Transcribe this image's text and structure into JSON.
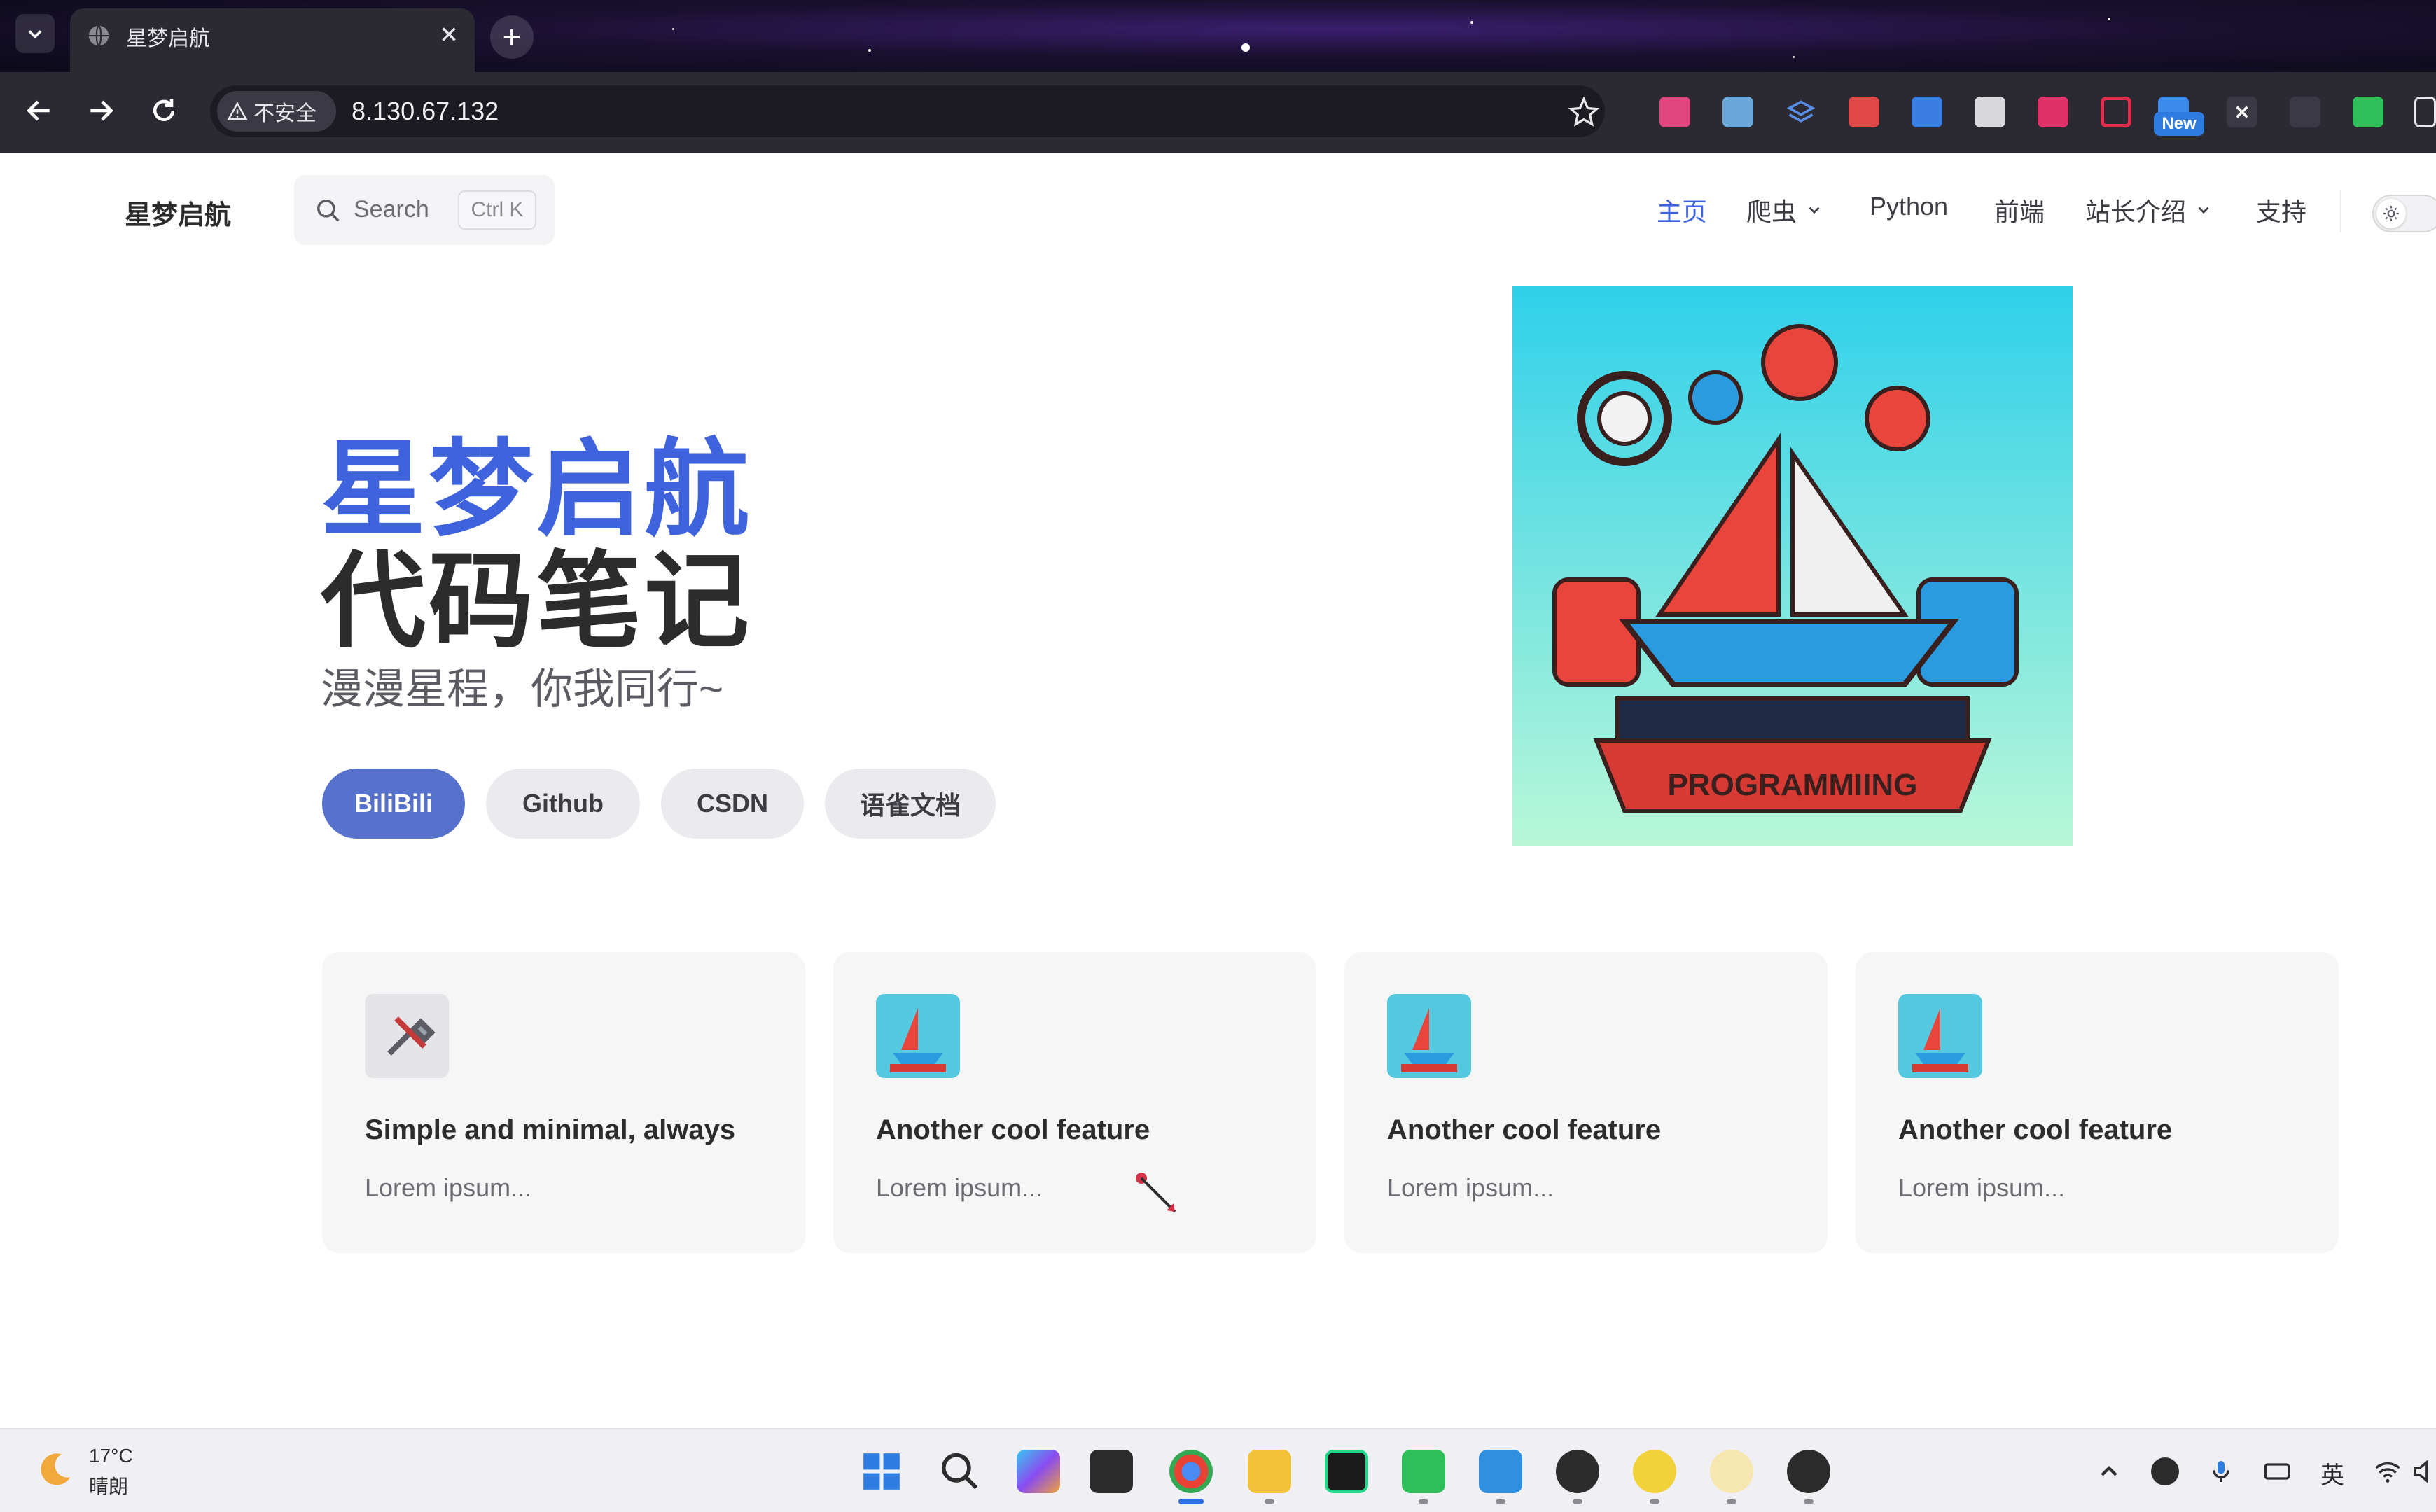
{
  "browser": {
    "tab_title": "星梦启航",
    "security_label": "不安全",
    "url": "8.130.67.132",
    "new_badge": "New"
  },
  "site": {
    "name": "星梦启航",
    "search": {
      "placeholder": "Search",
      "shortcut": "Ctrl K"
    },
    "nav": [
      {
        "label": "主页",
        "active": true,
        "dropdown": false
      },
      {
        "label": "爬虫",
        "active": false,
        "dropdown": true
      },
      {
        "label": "Python",
        "active": false,
        "dropdown": false
      },
      {
        "label": "前端",
        "active": false,
        "dropdown": false
      },
      {
        "label": "站长介绍",
        "active": false,
        "dropdown": true
      },
      {
        "label": "支持",
        "active": false,
        "dropdown": false
      }
    ],
    "accent_color": "#3e63dd"
  },
  "hero": {
    "name": "星梦启航",
    "text": "代码笔记",
    "tagline": "漫漫星程，你我同行~",
    "actions": [
      {
        "label": "BiliBili",
        "theme": "brand"
      },
      {
        "label": "Github",
        "theme": "alt"
      },
      {
        "label": "CSDN",
        "theme": "alt"
      },
      {
        "label": "语雀文档",
        "theme": "alt"
      }
    ],
    "image_text": "PROGRAMMIING"
  },
  "features": [
    {
      "icon": "tools-icon",
      "title": "Simple and minimal, always",
      "details": "Lorem ipsum..."
    },
    {
      "icon": "sailboat-logo-icon",
      "title": "Another cool feature",
      "details": "Lorem ipsum..."
    },
    {
      "icon": "sailboat-logo-icon",
      "title": "Another cool feature",
      "details": "Lorem ipsum..."
    },
    {
      "icon": "sailboat-logo-icon",
      "title": "Another cool feature",
      "details": "Lorem ipsum..."
    }
  ],
  "taskbar": {
    "weather": {
      "temp": "17°C",
      "desc": "晴朗"
    },
    "ime_label": "英"
  }
}
